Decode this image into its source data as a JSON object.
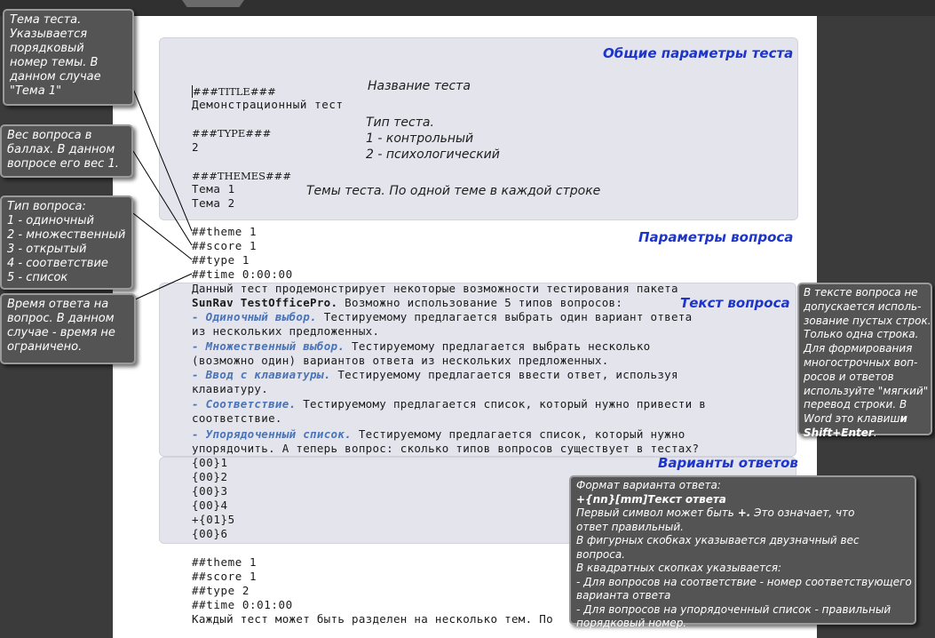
{
  "sections": {
    "general": "Общие параметры теста",
    "question_params": "Параметры вопроса",
    "question_text": "Текст вопроса",
    "answers": "Варианты ответов"
  },
  "notes": {
    "title_name": "Название теста",
    "type_head": "Тип теста.",
    "type_1": "1 - контрольный",
    "type_2": "2 - психологический",
    "themes": "Темы теста. По одной теме в каждой строке"
  },
  "code": {
    "title_tag": "###TITLE###",
    "title_value": "Демонстрационный тест",
    "type_tag": "###TYPE###",
    "type_value": "2",
    "themes_tag": "###THEMES###",
    "theme_1": "Тема 1",
    "theme_2": "Тема 2",
    "q1_theme": "##theme 1",
    "q1_score": "##score 1",
    "q1_type": "##type 1",
    "q1_time": "##time 0:00:00",
    "q1_text_1": "Данный тест продемонстрирует некоторые возможности тестирования пакета",
    "q1_text_2a": "SunRav TestOfficePro.",
    "q1_text_2b": " Возможно использование 5 типов вопросов:",
    "q1_opt1_dash": "- ",
    "q1_opt1_name": "Одиночный выбор.",
    "q1_opt1_rest": " Тестируемому предлагается выбрать один вариант ответа",
    "q1_opt1_cont": "из нескольких предложенных.",
    "q1_opt2_dash": "- ",
    "q1_opt2_name": "Множественный выбор.",
    "q1_opt2_rest": " Тестируемому предлагается выбрать несколько",
    "q1_opt2_cont": "(возможно один)  вариантов ответа из нескольких предложенных.",
    "q1_opt3_dash": "- ",
    "q1_opt3_name": "Ввод с клавиатуры.",
    "q1_opt3_rest": " Тестируемому предлагается ввести ответ, используя",
    "q1_opt3_cont": "клавиатуру.",
    "q1_opt4_dash": "- ",
    "q1_opt4_name": "Соответствие.",
    "q1_opt4_rest": " Тестируемому предлагается список, который нужно привести в",
    "q1_opt4_cont": "соответствие.",
    "q1_opt5_dash": "- ",
    "q1_opt5_name": "Упорядоченный список.",
    "q1_opt5_rest": " Тестируемому предлагается список, который нужно",
    "q1_opt5_cont": "упорядочить. А теперь вопрос: сколько типов вопросов существует в тестах?",
    "a1": "{00}1",
    "a2": "{00}2",
    "a3": "{00}3",
    "a4": "{00}4",
    "a5": "+{01}5",
    "a6": "{00}6",
    "q2_theme": "##theme 1",
    "q2_score": "##score 1",
    "q2_type": "##type 2",
    "q2_time": "##time 0:01:00",
    "q2_text_1": "Каждый тест может быть разделен на несколько тем. По"
  },
  "callouts": {
    "theme": [
      "Тема теста.",
      "Указывается",
      "порядковый",
      "номер темы. В",
      "данном случае",
      "\"Тема 1\""
    ],
    "score": [
      "Вес вопроса в",
      "баллах. В данном",
      "вопросе его вес 1."
    ],
    "type": [
      "Тип вопроса:",
      "1 - одиночный",
      "2 - множественный",
      "3 - открытый",
      "4 - соответствие",
      "5 - список"
    ],
    "time": [
      "Время ответа на",
      "вопрос. В данном",
      "случае - время не",
      "ограничено."
    ],
    "empty_lines": {
      "lines": [
        "В тексте вопроса не",
        "допускается исполь-",
        "зование пустых строк.",
        "Только одна строка.",
        "Для формирования",
        "многострочных воп-",
        "росов и ответов",
        "используйте \"мягкий\"",
        "перевод строки. В"
      ],
      "last_a": "Word это клавиш",
      "last_bold_1": "и",
      "last_bold_2": "Shift+Enter",
      "last_end": "."
    },
    "format": {
      "line1": "Формат варианта ответа:",
      "line2": "+{nn}[mm]Текст ответа",
      "line3a": "Первый символ может быть ",
      "line3b": "+.",
      "line3c": " Это означает, что",
      "rest": [
        "ответ правильный.",
        "В фигурных скобках указывается двузначный вес",
        "вопроса.",
        "В квадратных скопках указывается:",
        "- Для вопросов на соответствие - номер соответствующего",
        "варианта ответа",
        "- Для вопросов на упорядоченный список - правильный",
        "порядковый номер."
      ]
    }
  }
}
